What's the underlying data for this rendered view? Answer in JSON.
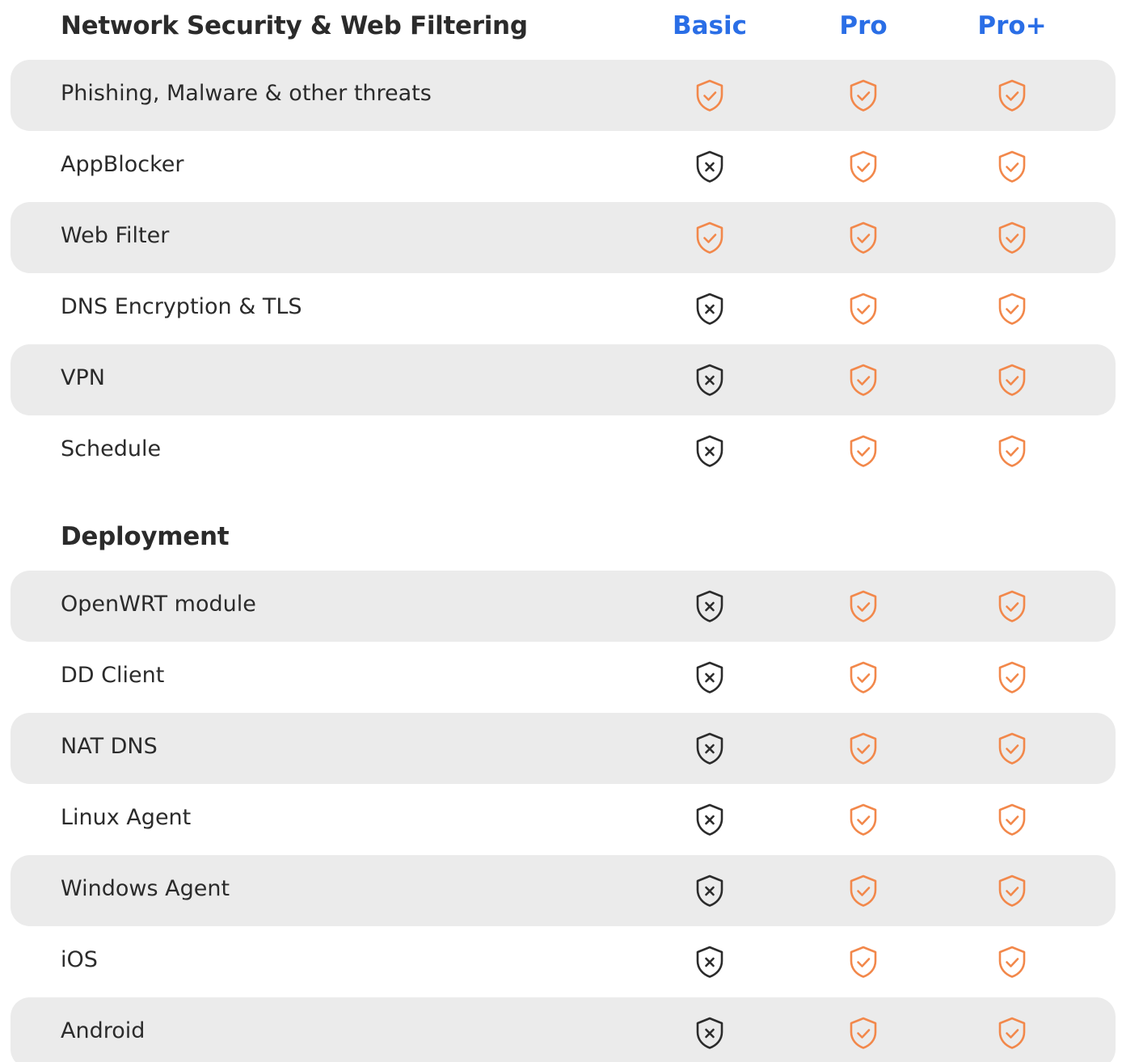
{
  "colors": {
    "plan_heading": "#2a6ee6",
    "included": "#f2884b",
    "excluded": "#2b2b2b",
    "row_shade": "#ebebeb",
    "text": "#2b2b2b"
  },
  "icons": {
    "included": "shield-check-icon",
    "excluded": "shield-x-icon"
  },
  "plans": [
    "Basic",
    "Pro",
    "Pro+"
  ],
  "sections": [
    {
      "title": "Network Security & Web Filtering",
      "show_plans": true,
      "features": [
        {
          "name": "Phishing, Malware & other threats",
          "availability": [
            true,
            true,
            true
          ]
        },
        {
          "name": "AppBlocker",
          "availability": [
            false,
            true,
            true
          ]
        },
        {
          "name": "Web Filter",
          "availability": [
            true,
            true,
            true
          ]
        },
        {
          "name": "DNS Encryption & TLS",
          "availability": [
            false,
            true,
            true
          ]
        },
        {
          "name": "VPN",
          "availability": [
            false,
            true,
            true
          ]
        },
        {
          "name": "Schedule",
          "availability": [
            false,
            true,
            true
          ]
        }
      ]
    },
    {
      "title": "Deployment",
      "show_plans": false,
      "features": [
        {
          "name": "OpenWRT module",
          "availability": [
            false,
            true,
            true
          ]
        },
        {
          "name": "DD Client",
          "availability": [
            false,
            true,
            true
          ]
        },
        {
          "name": "NAT DNS",
          "availability": [
            false,
            true,
            true
          ]
        },
        {
          "name": "Linux Agent",
          "availability": [
            false,
            true,
            true
          ]
        },
        {
          "name": "Windows Agent",
          "availability": [
            false,
            true,
            true
          ]
        },
        {
          "name": "iOS",
          "availability": [
            false,
            true,
            true
          ]
        },
        {
          "name": "Android",
          "availability": [
            false,
            true,
            true
          ]
        }
      ]
    }
  ]
}
